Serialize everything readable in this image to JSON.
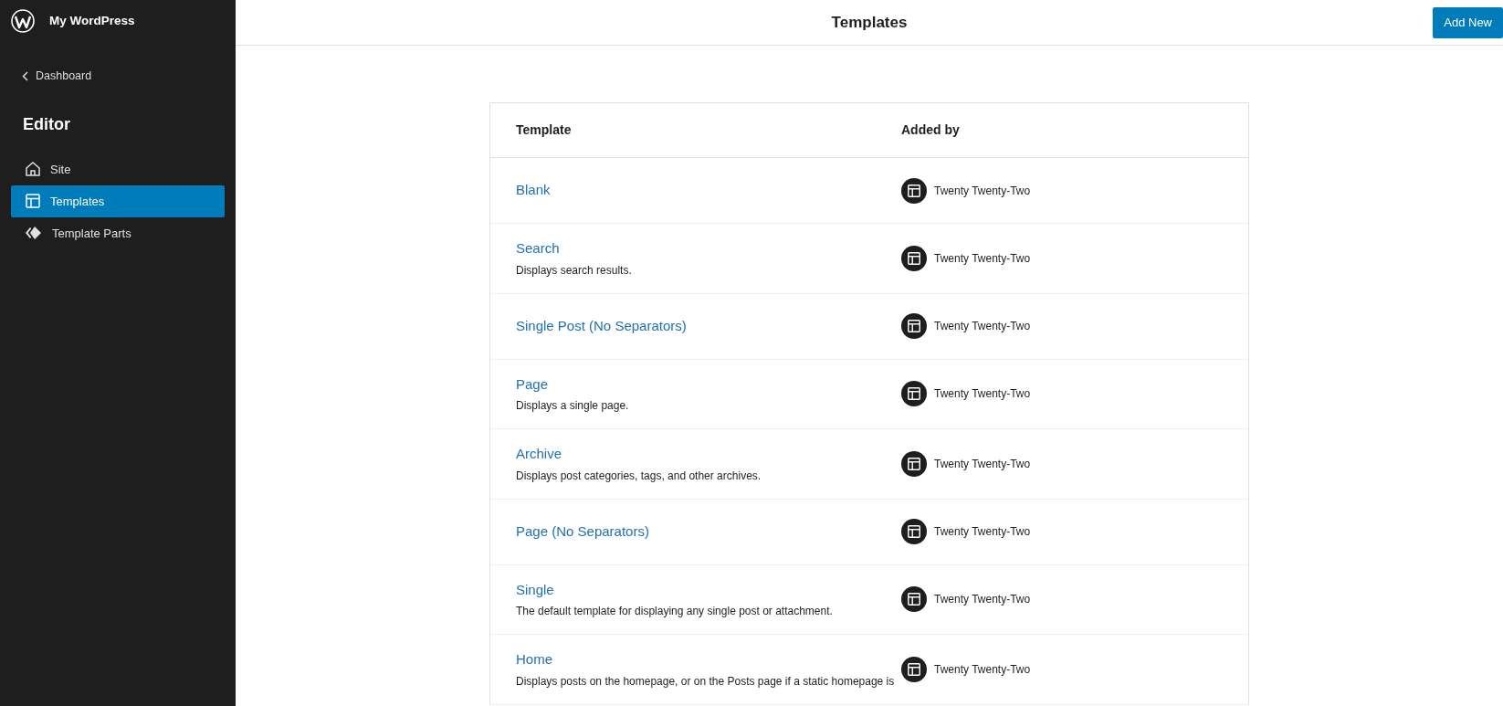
{
  "site_title": "My WordPress",
  "back_link": "Dashboard",
  "sidebar": {
    "heading": "Editor",
    "items": [
      {
        "label": "Site",
        "kind": "site",
        "selected": false
      },
      {
        "label": "Templates",
        "kind": "templates",
        "selected": true
      },
      {
        "label": "Template Parts",
        "kind": "parts",
        "selected": false
      }
    ]
  },
  "header": {
    "title": "Templates",
    "button": "Add New"
  },
  "table": {
    "columns": [
      "Template",
      "Added by"
    ],
    "rows": [
      {
        "title": "Blank",
        "added_by": "Twenty Twenty-Two"
      },
      {
        "title": "Search",
        "description": "Displays search results.",
        "added_by": "Twenty Twenty-Two"
      },
      {
        "title": "Single Post (No Separators)",
        "added_by": "Twenty Twenty-Two"
      },
      {
        "title": "Page",
        "description": "Displays a single page.",
        "added_by": "Twenty Twenty-Two"
      },
      {
        "title": "Archive",
        "description": "Displays post categories, tags, and other archives.",
        "added_by": "Twenty Twenty-Two"
      },
      {
        "title": "Page (No Separators)",
        "added_by": "Twenty Twenty-Two"
      },
      {
        "title": "Single",
        "description": "The default template for displaying any single post or attachment.",
        "added_by": "Twenty Twenty-Two"
      },
      {
        "title": "Home",
        "description": "Displays posts on the homepage, or on the Posts page if a static homepage is",
        "added_by": "Twenty Twenty-Two"
      }
    ]
  }
}
